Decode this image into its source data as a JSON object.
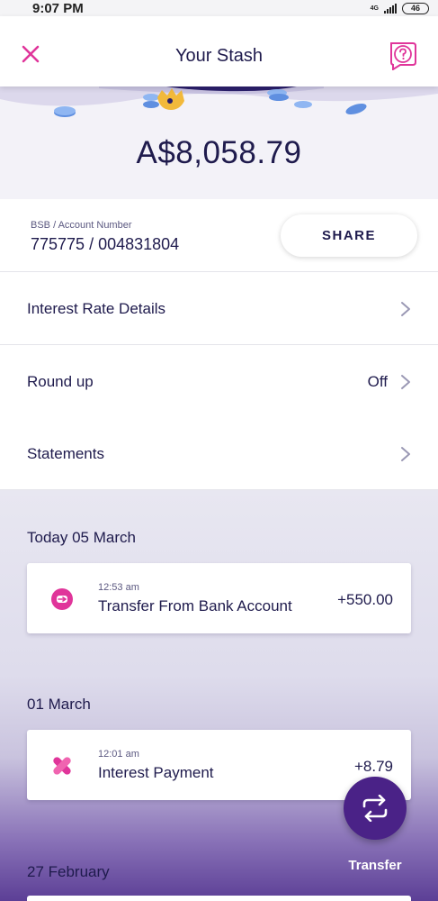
{
  "status_bar": {
    "time": "9:07 PM",
    "network": "4G",
    "battery": "46"
  },
  "header": {
    "title": "Your Stash",
    "close_icon": "close-icon",
    "help_icon": "help-chat-icon",
    "accent_color": "#e0359a"
  },
  "balance": {
    "amount": "A$8,058.79"
  },
  "account": {
    "label": "BSB / Account Number",
    "number": "775775 / 004831804",
    "share_label": "SHARE"
  },
  "menu": [
    {
      "label": "Interest Rate Details",
      "value": ""
    },
    {
      "label": "Round up",
      "value": "Off"
    },
    {
      "label": "Statements",
      "value": ""
    }
  ],
  "transactions": [
    {
      "date": "Today 05 March",
      "items": [
        {
          "time": "12:53 am",
          "description": "Transfer From Bank Account",
          "amount": "+550.00",
          "icon": "bank-transfer-icon"
        }
      ]
    },
    {
      "date": "01 March",
      "items": [
        {
          "time": "12:01 am",
          "description": "Interest Payment",
          "amount": "+8.79",
          "icon": "interest-icon"
        }
      ]
    },
    {
      "date": "27 February",
      "items": []
    }
  ],
  "fab": {
    "label": "Transfer",
    "icon": "transfer-arrows-icon",
    "color": "#4a2287"
  }
}
